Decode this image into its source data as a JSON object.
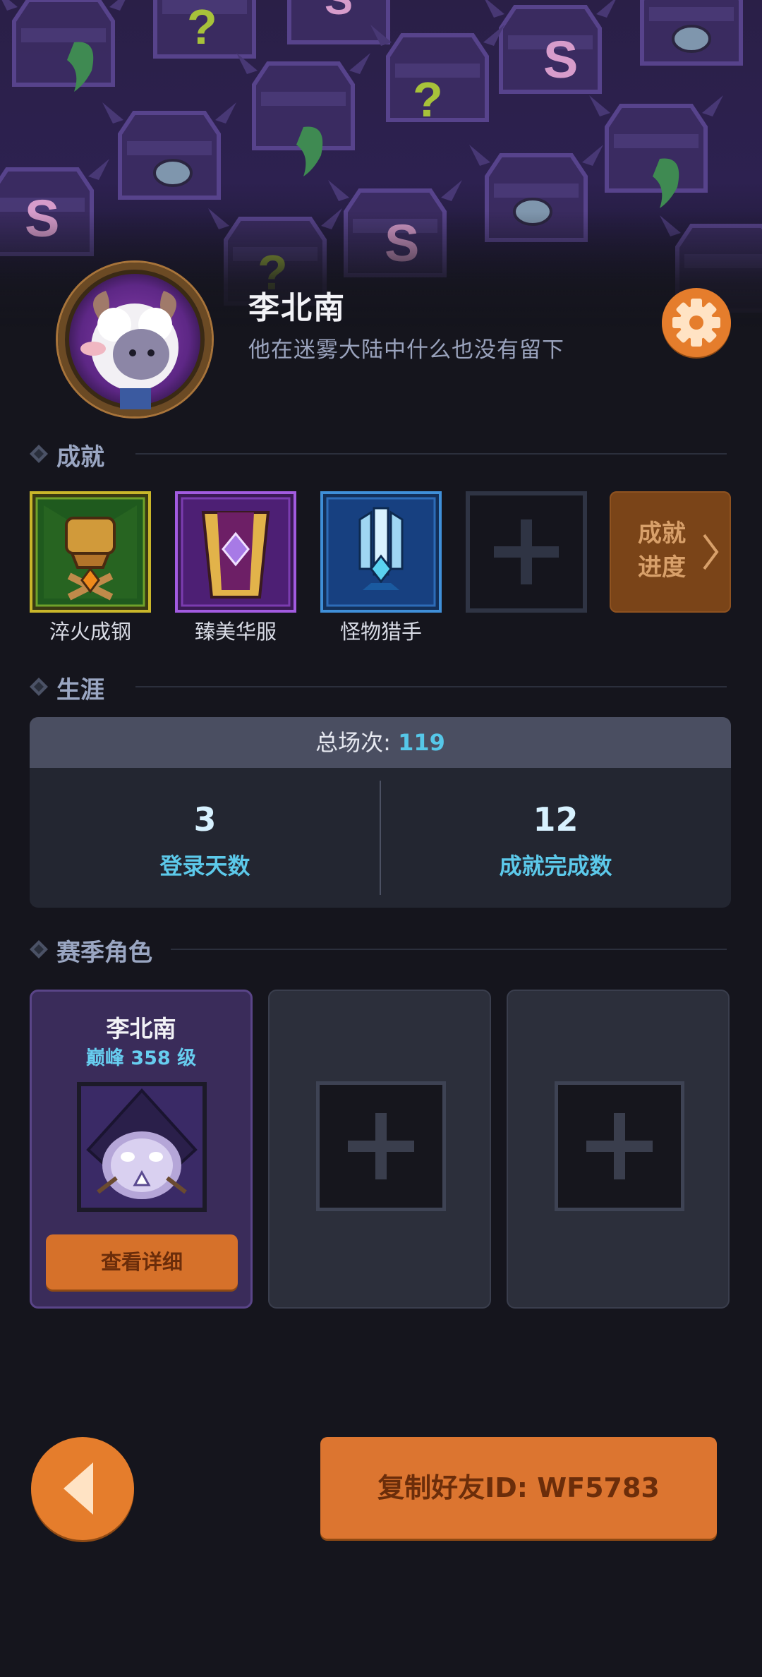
{
  "profile": {
    "name": "李北南",
    "bio": "他在迷雾大陆中什么也没有留下"
  },
  "sections": {
    "achievements": "成就",
    "career": "生涯",
    "season_roles": "赛季角色"
  },
  "achievements": {
    "items": [
      {
        "label": "淬火成钢",
        "icon": "fist-shield-icon",
        "frame_color": "#c9b62a"
      },
      {
        "label": "臻美华服",
        "icon": "robe-gem-icon",
        "frame_color": "#a25be0"
      },
      {
        "label": "怪物猎手",
        "icon": "crystal-blade-icon",
        "frame_color": "#3f8fd8"
      }
    ],
    "empty_slot_icon": "plus-icon",
    "progress_button": {
      "line1": "成就",
      "line2": "进度",
      "icon": "chevron-right-icon"
    }
  },
  "career": {
    "total_label": "总场次: ",
    "total_value": "119",
    "stats": [
      {
        "value": "3",
        "label": "登录天数"
      },
      {
        "value": "12",
        "label": "成就完成数"
      }
    ]
  },
  "season_roles": {
    "filled": {
      "name": "李北南",
      "level": "巅峰 358 级",
      "button": "查看详细"
    },
    "empty_slots": 2
  },
  "footer": {
    "copy_button": "复制好友ID: WF5783",
    "back_icon": "back-arrow-icon"
  },
  "colors": {
    "accent_orange": "#e57d2c",
    "stat_cyan": "#5cc9ea",
    "background": "#15151d"
  }
}
